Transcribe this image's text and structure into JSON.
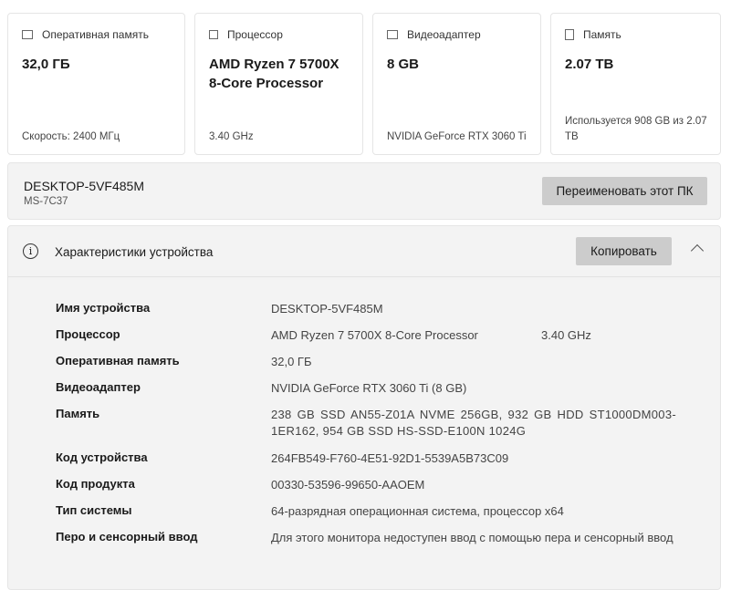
{
  "cards": [
    {
      "icon": "memory-icon",
      "label": "Оперативная память",
      "value": "32,0 ГБ",
      "sub": "Скорость: 2400 МГц"
    },
    {
      "icon": "processor-icon",
      "label": "Процессор",
      "value": "AMD Ryzen 7 5700X 8-Core Processor",
      "sub": "3.40 GHz"
    },
    {
      "icon": "display-adapter-icon",
      "label": "Видеоадаптер",
      "value": "8 GB",
      "sub": "NVIDIA GeForce RTX 3060 Ti"
    },
    {
      "icon": "storage-icon",
      "label": "Память",
      "value": "2.07 TB",
      "sub": "Используется 908 GB из 2.07 TB"
    }
  ],
  "device": {
    "name": "DESKTOP-5VF485M",
    "model": "MS-7C37",
    "rename_label": "Переименовать этот ПК"
  },
  "specs": {
    "title": "Характеристики устройства",
    "copy_label": "Копировать",
    "rows": [
      {
        "key": "Имя устройства",
        "value": "DESKTOP-5VF485M"
      },
      {
        "key": "Процессор",
        "value": "AMD Ryzen 7 5700X 8-Core Processor",
        "extra": "3.40 GHz"
      },
      {
        "key": "Оперативная память",
        "value": "32,0 ГБ"
      },
      {
        "key": "Видеоадаптер",
        "value": "NVIDIA GeForce RTX 3060 Ti (8 GB)"
      },
      {
        "key": "Память",
        "value": "238 GB SSD AN55-Z01A NVME 256GB, 932 GB HDD ST1000DM003-1ER162, 954 GB SSD HS-SSD-E100N 1024G"
      },
      {
        "key": "Код устройства",
        "value": "264FB549-F760-4E51-92D1-5539A5B73C09"
      },
      {
        "key": "Код продукта",
        "value": "00330-53596-99650-AAOEM"
      },
      {
        "key": "Тип системы",
        "value": "64-разрядная операционная система, процессор x64"
      },
      {
        "key": "Перо и сенсорный ввод",
        "value": "Для этого монитора недоступен ввод с помощью пера и сенсорный ввод"
      }
    ]
  }
}
